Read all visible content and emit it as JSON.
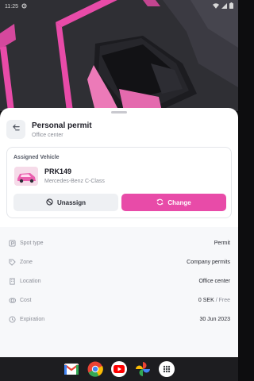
{
  "status_bar": {
    "time": "11:25",
    "icons": [
      "gear-icon",
      "wifi-icon",
      "signal-icon",
      "battery-icon"
    ]
  },
  "colors": {
    "accent": "#e84ba8",
    "map_bg": "#2b2a2f",
    "parking_line": "#e84ba8",
    "car_body": "#ec7ab8"
  },
  "header": {
    "title": "Personal permit",
    "subtitle": "Office center",
    "back_icon": "swap-back-icon"
  },
  "vehicle_card": {
    "label": "Assigned Vehicle",
    "plate": "PRK149",
    "model": "Mercedes-Benz C-Class",
    "unassign_label": "Unassign",
    "change_label": "Change"
  },
  "details": [
    {
      "icon": "parking-sign-icon",
      "label": "Spot type",
      "value": "Permit",
      "suffix": ""
    },
    {
      "icon": "tag-icon",
      "label": "Zone",
      "value": "Company permits",
      "suffix": ""
    },
    {
      "icon": "building-icon",
      "label": "Location",
      "value": "Office center",
      "suffix": ""
    },
    {
      "icon": "coins-icon",
      "label": "Cost",
      "value": "0 SEK",
      "suffix": " / Free"
    },
    {
      "icon": "clock-icon",
      "label": "Expiration",
      "value": "30 Jun 2023",
      "suffix": ""
    }
  ],
  "dock": {
    "apps": [
      "gmail-icon",
      "chrome-icon",
      "youtube-icon",
      "photos-icon",
      "app-drawer-icon"
    ]
  }
}
